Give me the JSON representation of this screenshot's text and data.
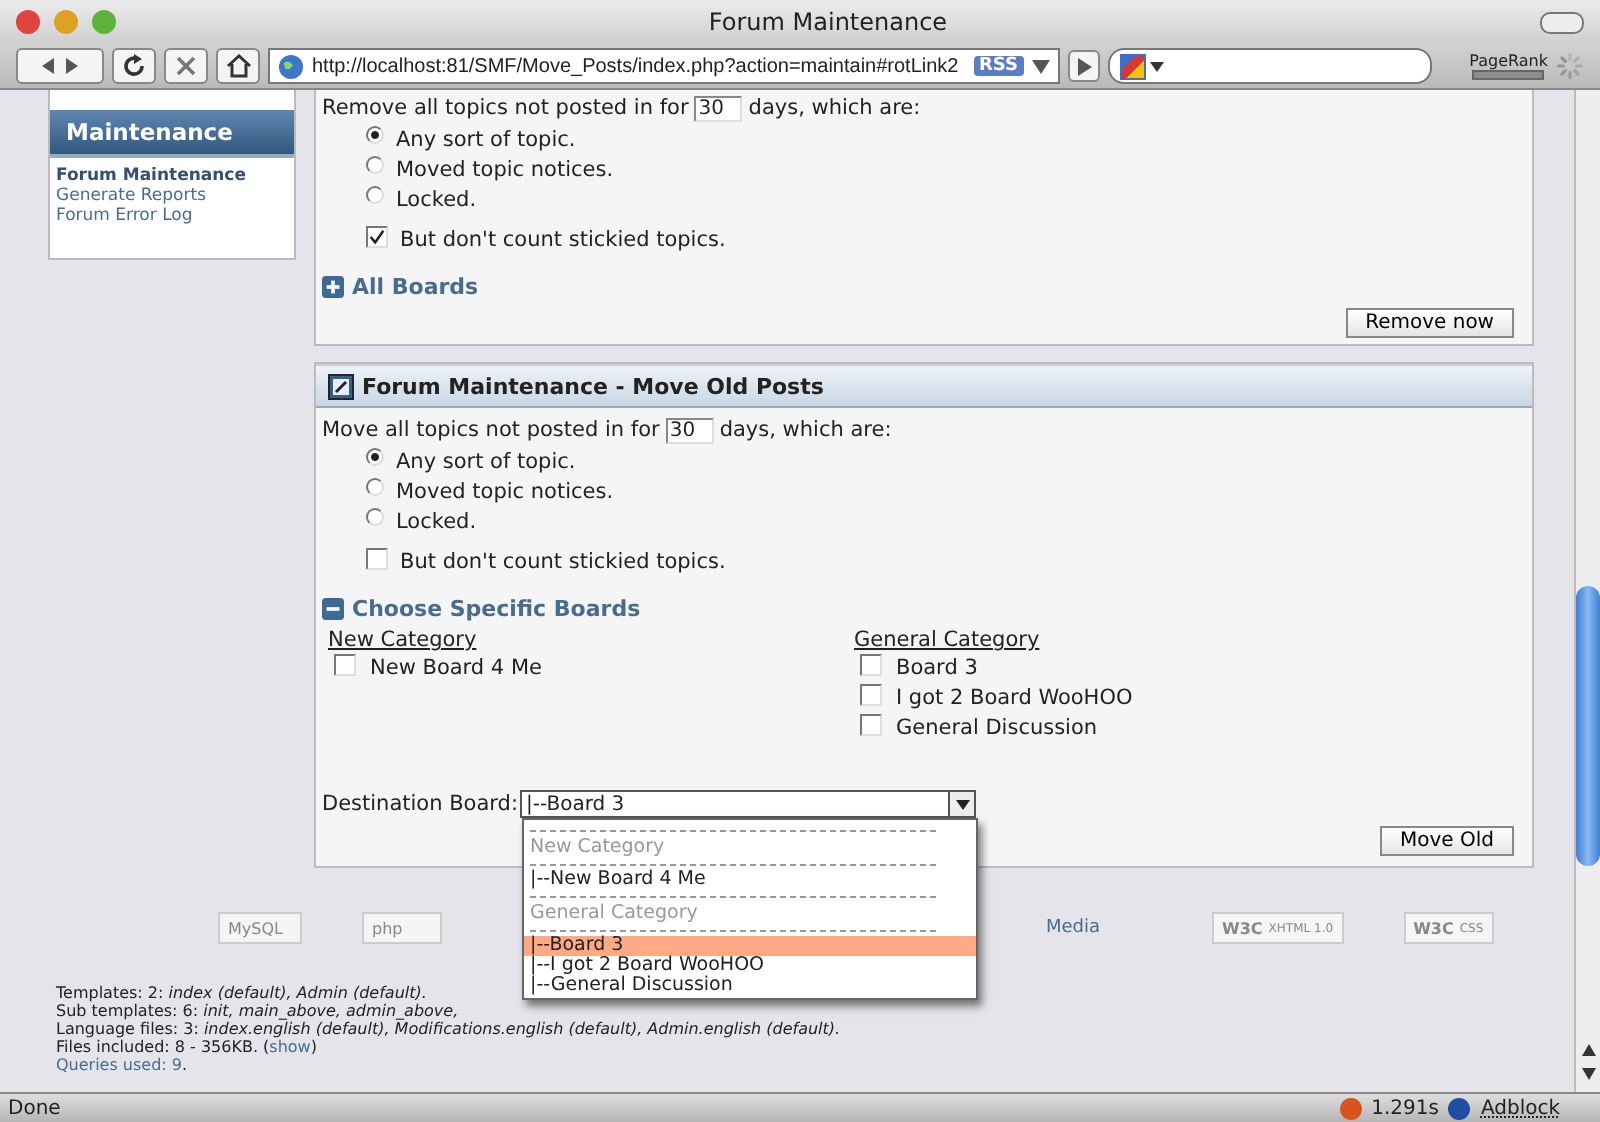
{
  "window": {
    "title": "Forum Maintenance"
  },
  "toolbar": {
    "url": "http://localhost:81/SMF/Move_Posts/index.php?action=maintain#rotLink2",
    "rss": "RSS",
    "pagerank": "PageRank"
  },
  "sidebar": {
    "title": "Maintenance",
    "items": [
      {
        "label": "Forum Maintenance",
        "selected": true
      },
      {
        "label": "Generate Reports",
        "selected": false
      },
      {
        "label": "Forum Error Log",
        "selected": false
      }
    ]
  },
  "remove_section": {
    "prefix": "Remove all topics not posted in for",
    "days": "30",
    "suffix": "days, which are:",
    "options": [
      {
        "label": "Any sort of topic.",
        "selected": true
      },
      {
        "label": "Moved topic notices.",
        "selected": false
      },
      {
        "label": "Locked.",
        "selected": false
      }
    ],
    "sticky": {
      "label": "But don't count stickied topics.",
      "checked": true
    },
    "boards_toggle": {
      "label": "All Boards",
      "expanded": false
    },
    "button": "Remove now"
  },
  "move_section": {
    "title": "Forum Maintenance - Move Old Posts",
    "prefix": "Move all topics not posted in for",
    "days": "30",
    "suffix": "days, which are:",
    "options": [
      {
        "label": "Any sort of topic.",
        "selected": true
      },
      {
        "label": "Moved topic notices.",
        "selected": false
      },
      {
        "label": "Locked.",
        "selected": false
      }
    ],
    "sticky": {
      "label": "But don't count stickied topics.",
      "checked": false
    },
    "boards_toggle": {
      "label": "Choose Specific Boards",
      "expanded": true
    },
    "categories": [
      {
        "name": "New Category",
        "boards": [
          {
            "label": "New Board 4 Me",
            "checked": false
          }
        ]
      },
      {
        "name": "General Category",
        "boards": [
          {
            "label": "Board 3",
            "checked": false
          },
          {
            "label": "I got 2 Board WooHOO",
            "checked": false
          },
          {
            "label": "General Discussion",
            "checked": false
          }
        ]
      }
    ],
    "destination": {
      "label": "Destination Board:",
      "value": "|--Board 3"
    },
    "button": "Move Old"
  },
  "dropdown": {
    "items": [
      {
        "kind": "separator"
      },
      {
        "kind": "category",
        "label": "New Category"
      },
      {
        "kind": "separator"
      },
      {
        "kind": "board",
        "label": "|--New Board 4 Me",
        "selected": false
      },
      {
        "kind": "separator"
      },
      {
        "kind": "category",
        "label": "General Category"
      },
      {
        "kind": "separator"
      },
      {
        "kind": "board",
        "label": "|--Board 3",
        "selected": true
      },
      {
        "kind": "board",
        "label": "|--I got 2 Board WooHOO",
        "selected": false
      },
      {
        "kind": "board",
        "label": "|--General Discussion",
        "selected": false
      }
    ]
  },
  "footer": {
    "badges": [
      {
        "kind": "mysql",
        "label": "MySQL"
      },
      {
        "kind": "php",
        "label": "php"
      },
      {
        "kind": "link",
        "label": "Media"
      },
      {
        "kind": "w3c",
        "label": "W3C",
        "sub": "XHTML 1.0"
      },
      {
        "kind": "w3c",
        "label": "W3C",
        "sub": "CSS"
      }
    ],
    "stats": [
      "Templates: 2: *index (default), Admin (default).*",
      "Sub templates: 6: *init, main_above, admin_above,*",
      "Language files: 3: *index.english (default), Modifications.english (default), Admin.english (default).*"
    ],
    "files": {
      "before": "Files included: 8 - 356KB. (",
      "link": "show",
      "after": ")"
    },
    "queries": {
      "link": "Queries used: 9",
      "after": "."
    }
  },
  "status_bar": {
    "text": "Done",
    "timer": "1.291s",
    "adblock": "Adblock"
  }
}
